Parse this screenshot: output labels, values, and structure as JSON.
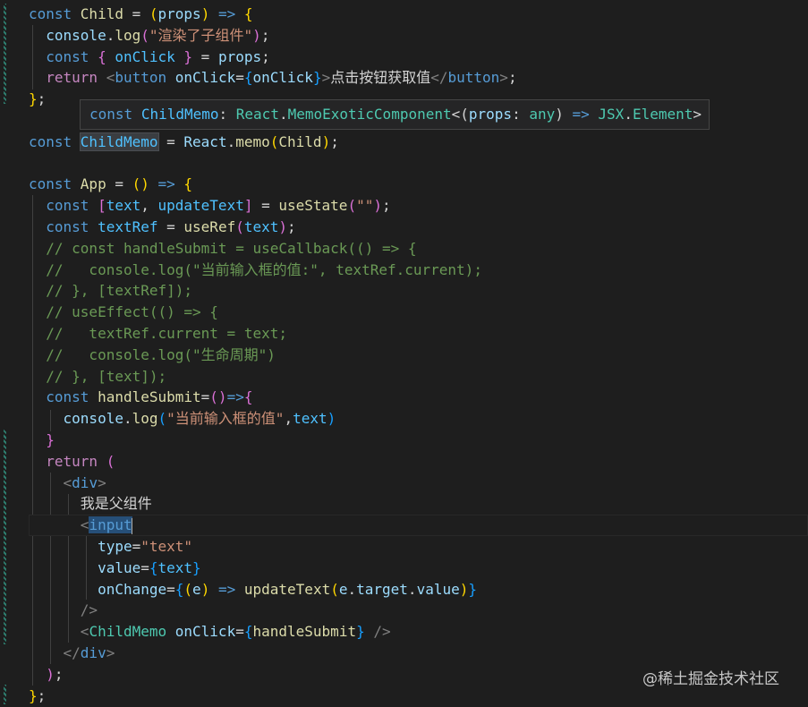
{
  "hover_tooltip": {
    "kw": "const",
    "name": "ChildMemo",
    "colon": ": ",
    "ns": "React",
    "dot": ".",
    "type": "MemoExoticComponent",
    "open": "<(",
    "param": "props",
    "colon2": ": ",
    "any": "any",
    "close": ")",
    "arrow": " => ",
    "jsx": "JSX",
    "dot2": ".",
    "element": "Element",
    "end": ">"
  },
  "watermark": "@稀土掘金技术社区",
  "code_lines": [
    [
      [
        "kw",
        "const "
      ],
      [
        "fn",
        "Child"
      ],
      [
        "txt",
        " = "
      ],
      [
        "b1",
        "("
      ],
      [
        "var",
        "props"
      ],
      [
        "b1",
        ")"
      ],
      [
        "txt",
        " "
      ],
      [
        "kw",
        "=>"
      ],
      [
        "txt",
        " "
      ],
      [
        "b1",
        "{"
      ]
    ],
    [
      [
        "txt",
        "  "
      ],
      [
        "var",
        "console"
      ],
      [
        "txt",
        "."
      ],
      [
        "fn",
        "log"
      ],
      [
        "b2",
        "("
      ],
      [
        "str",
        "\"渲染了子组件\""
      ],
      [
        "b2",
        ")"
      ],
      [
        "txt",
        ";"
      ]
    ],
    [
      [
        "txt",
        "  "
      ],
      [
        "kw",
        "const "
      ],
      [
        "b2",
        "{ "
      ],
      [
        "cst",
        "onClick"
      ],
      [
        "b2",
        " }"
      ],
      [
        "txt",
        " = "
      ],
      [
        "var",
        "props"
      ],
      [
        "txt",
        ";"
      ]
    ],
    [
      [
        "txt",
        "  "
      ],
      [
        "ctl",
        "return "
      ],
      [
        "punc",
        "<"
      ],
      [
        "tag",
        "button "
      ],
      [
        "var",
        "onClick"
      ],
      [
        "txt",
        "="
      ],
      [
        "b3",
        "{"
      ],
      [
        "var",
        "onClick"
      ],
      [
        "b3",
        "}"
      ],
      [
        "punc",
        ">"
      ],
      [
        "txt",
        "点击按钮获取值"
      ],
      [
        "punc",
        "</"
      ],
      [
        "tag",
        "button"
      ],
      [
        "punc",
        ">"
      ],
      [
        "txt",
        ";"
      ]
    ],
    [
      [
        "b1",
        "}"
      ],
      [
        "txt",
        ";"
      ]
    ],
    [],
    [
      [
        "kw",
        "const "
      ],
      [
        "cst",
        "ChildMemo"
      ],
      [
        "txt",
        " = "
      ],
      [
        "var",
        "React"
      ],
      [
        "txt",
        "."
      ],
      [
        "fn",
        "memo"
      ],
      [
        "b1",
        "("
      ],
      [
        "fn",
        "Child"
      ],
      [
        "b1",
        ")"
      ],
      [
        "txt",
        ";"
      ]
    ],
    [],
    [
      [
        "kw",
        "const "
      ],
      [
        "fn",
        "App"
      ],
      [
        "txt",
        " = "
      ],
      [
        "b1",
        "()"
      ],
      [
        "txt",
        " "
      ],
      [
        "kw",
        "=>"
      ],
      [
        "txt",
        " "
      ],
      [
        "b1",
        "{"
      ]
    ],
    [
      [
        "txt",
        "  "
      ],
      [
        "kw",
        "const "
      ],
      [
        "b2",
        "["
      ],
      [
        "cst",
        "text"
      ],
      [
        "txt",
        ", "
      ],
      [
        "cst",
        "updateText"
      ],
      [
        "b2",
        "]"
      ],
      [
        "txt",
        " = "
      ],
      [
        "fn",
        "useState"
      ],
      [
        "b2",
        "("
      ],
      [
        "str",
        "\"\""
      ],
      [
        "b2",
        ")"
      ],
      [
        "txt",
        ";"
      ]
    ],
    [
      [
        "txt",
        "  "
      ],
      [
        "kw",
        "const "
      ],
      [
        "cst",
        "textRef"
      ],
      [
        "txt",
        " = "
      ],
      [
        "fn",
        "useRef"
      ],
      [
        "b2",
        "("
      ],
      [
        "cst",
        "text"
      ],
      [
        "b2",
        ")"
      ],
      [
        "txt",
        ";"
      ]
    ],
    [
      [
        "txt",
        "  "
      ],
      [
        "cmt",
        "// const handleSubmit = useCallback(() => {"
      ]
    ],
    [
      [
        "txt",
        "  "
      ],
      [
        "cmt",
        "//   console.log(\"当前输入框的值:\", textRef.current);"
      ]
    ],
    [
      [
        "txt",
        "  "
      ],
      [
        "cmt",
        "// }, [textRef]);"
      ]
    ],
    [
      [
        "txt",
        "  "
      ],
      [
        "cmt",
        "// useEffect(() => {"
      ]
    ],
    [
      [
        "txt",
        "  "
      ],
      [
        "cmt",
        "//   textRef.current = text;"
      ]
    ],
    [
      [
        "txt",
        "  "
      ],
      [
        "cmt",
        "//   console.log(\"生命周期\")"
      ]
    ],
    [
      [
        "txt",
        "  "
      ],
      [
        "cmt",
        "// }, [text]);"
      ]
    ],
    [
      [
        "txt",
        "  "
      ],
      [
        "kw",
        "const "
      ],
      [
        "fn",
        "handleSubmit"
      ],
      [
        "txt",
        "="
      ],
      [
        "b2",
        "()"
      ],
      [
        "kw",
        "=>"
      ],
      [
        "b2",
        "{"
      ]
    ],
    [
      [
        "txt",
        "    "
      ],
      [
        "var",
        "console"
      ],
      [
        "txt",
        "."
      ],
      [
        "fn",
        "log"
      ],
      [
        "b3",
        "("
      ],
      [
        "str",
        "\"当前输入框的值\""
      ],
      [
        "txt",
        ","
      ],
      [
        "cst",
        "text"
      ],
      [
        "b3",
        ")"
      ]
    ],
    [
      [
        "txt",
        "  "
      ],
      [
        "b2",
        "}"
      ]
    ],
    [
      [
        "txt",
        "  "
      ],
      [
        "ctl",
        "return "
      ],
      [
        "b2",
        "("
      ]
    ],
    [
      [
        "txt",
        "    "
      ],
      [
        "punc",
        "<"
      ],
      [
        "tag",
        "div"
      ],
      [
        "punc",
        ">"
      ]
    ],
    [
      [
        "txt",
        "      我是父组件"
      ]
    ],
    [
      [
        "txt",
        "      "
      ],
      [
        "punc",
        "<"
      ],
      [
        "tag",
        "input"
      ]
    ],
    [
      [
        "txt",
        "        "
      ],
      [
        "var",
        "type"
      ],
      [
        "txt",
        "="
      ],
      [
        "str",
        "\"text\""
      ]
    ],
    [
      [
        "txt",
        "        "
      ],
      [
        "var",
        "value"
      ],
      [
        "txt",
        "="
      ],
      [
        "b3",
        "{"
      ],
      [
        "cst",
        "text"
      ],
      [
        "b3",
        "}"
      ]
    ],
    [
      [
        "txt",
        "        "
      ],
      [
        "var",
        "onChange"
      ],
      [
        "txt",
        "="
      ],
      [
        "b3",
        "{"
      ],
      [
        "b1",
        "("
      ],
      [
        "var",
        "e"
      ],
      [
        "b1",
        ")"
      ],
      [
        "txt",
        " "
      ],
      [
        "kw",
        "=>"
      ],
      [
        "txt",
        " "
      ],
      [
        "fn",
        "updateText"
      ],
      [
        "b1",
        "("
      ],
      [
        "var",
        "e"
      ],
      [
        "txt",
        "."
      ],
      [
        "var",
        "target"
      ],
      [
        "txt",
        "."
      ],
      [
        "var",
        "value"
      ],
      [
        "b1",
        ")"
      ],
      [
        "b3",
        "}"
      ]
    ],
    [
      [
        "txt",
        "      "
      ],
      [
        "punc",
        "/>"
      ]
    ],
    [
      [
        "txt",
        "      "
      ],
      [
        "punc",
        "<"
      ],
      [
        "typ",
        "ChildMemo "
      ],
      [
        "var",
        "onClick"
      ],
      [
        "txt",
        "="
      ],
      [
        "b3",
        "{"
      ],
      [
        "fn",
        "handleSubmit"
      ],
      [
        "b3",
        "}"
      ],
      [
        "txt",
        " "
      ],
      [
        "punc",
        "/>"
      ]
    ],
    [
      [
        "txt",
        "    "
      ],
      [
        "punc",
        "</"
      ],
      [
        "tag",
        "div"
      ],
      [
        "punc",
        ">"
      ]
    ],
    [
      [
        "txt",
        "  "
      ],
      [
        "b2",
        ")"
      ],
      [
        "txt",
        ";"
      ]
    ],
    [
      [
        "b1",
        "}"
      ],
      [
        "txt",
        ";"
      ]
    ]
  ]
}
